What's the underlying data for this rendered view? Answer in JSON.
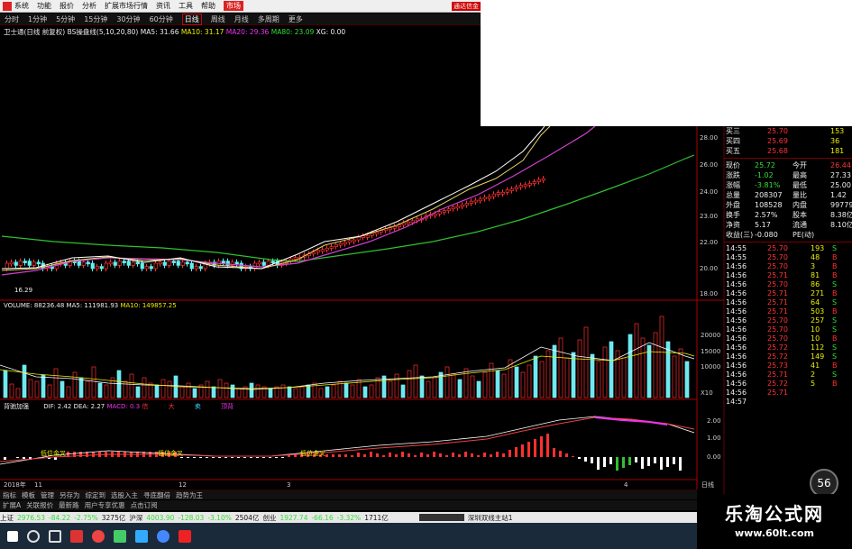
{
  "menu": {
    "items": [
      "系统",
      "功能",
      "报价",
      "分析",
      "扩展市场行情",
      "资讯",
      "工具",
      "帮助"
    ],
    "market": "市场",
    "top_right": "通达信金"
  },
  "toolbar": {
    "items": [
      "分时",
      "1分钟",
      "5分钟",
      "15分钟",
      "30分钟",
      "60分钟",
      "日线",
      "周线",
      "月线",
      "多周期",
      "更多"
    ],
    "active": "日线"
  },
  "info": {
    "stock": "卫士通(日线 前复权)",
    "indicator": "BS操盘线(5,10,20,80)",
    "ma5": "MA5: 31.66",
    "ma10": "MA10: 31.17",
    "ma20": "MA20: 29.36",
    "ma80": "MA80: 23.09",
    "xg": "XG: 0.00"
  },
  "price_axis": [
    "28.00",
    "26.00",
    "24.00",
    "23.00",
    "22.00",
    "20.00",
    "18.00"
  ],
  "low_label": "16.29",
  "volume": {
    "label": "VOLUME: 88236.48",
    "ma5": "MA5: 111981.93",
    "ma10": "MA10: 149857.25",
    "axis": [
      "20000",
      "15000",
      "10000"
    ],
    "unit": "X10"
  },
  "macd": {
    "name": "背驰加强",
    "dif": "DIF: 2.42",
    "dea": "DEA: 2.27",
    "macd": "MACD: 0.3",
    "axis": [
      "2.00",
      "1.00",
      "0.00"
    ],
    "labels": [
      "低位金叉",
      "低位金叉",
      "低位金叉"
    ],
    "legend": [
      "信",
      "大",
      "卖",
      "顶背"
    ]
  },
  "time_axis": [
    "2018年",
    "11",
    "12",
    "3",
    "4"
  ],
  "time_unit": "日线",
  "quote": {
    "rows": [
      {
        "label": "买三",
        "price": "25.70",
        "vol": "153"
      },
      {
        "label": "买四",
        "price": "25.69",
        "vol": "36"
      },
      {
        "label": "买五",
        "price": "25.68",
        "vol": "181"
      }
    ],
    "info": [
      {
        "l1": "现价",
        "v1": "25.72",
        "l2": "今开",
        "v2": "26.44"
      },
      {
        "l1": "涨跌",
        "v1": "-1.02",
        "l2": "最高",
        "v2": "27.33"
      },
      {
        "l1": "涨幅",
        "v1": "-3.81%",
        "l2": "最低",
        "v2": "25.00"
      },
      {
        "l1": "总量",
        "v1": "208307",
        "l2": "量比",
        "v2": "1.42"
      },
      {
        "l1": "外盘",
        "v1": "108528",
        "l2": "内盘",
        "v2": "99779"
      },
      {
        "l1": "换手",
        "v1": "2.57%",
        "l2": "股本",
        "v2": "8.38亿"
      },
      {
        "l1": "净资",
        "v1": "5.17",
        "l2": "流通",
        "v2": "8.10亿"
      },
      {
        "l1": "收益(三)",
        "v1": "-0.080",
        "l2": "PE(动)",
        "v2": ""
      }
    ],
    "trades": [
      {
        "t": "14:55",
        "p": "25.70",
        "v": "193",
        "d": "S"
      },
      {
        "t": "14:55",
        "p": "25.70",
        "v": "48",
        "d": "B"
      },
      {
        "t": "14:56",
        "p": "25.70",
        "v": "3",
        "d": "B"
      },
      {
        "t": "14:56",
        "p": "25.71",
        "v": "81",
        "d": "B"
      },
      {
        "t": "14:56",
        "p": "25.70",
        "v": "86",
        "d": "S"
      },
      {
        "t": "14:56",
        "p": "25.71",
        "v": "271",
        "d": "B"
      },
      {
        "t": "14:56",
        "p": "25.71",
        "v": "64",
        "d": "S"
      },
      {
        "t": "14:56",
        "p": "25.71",
        "v": "503",
        "d": "B"
      },
      {
        "t": "14:56",
        "p": "25.70",
        "v": "257",
        "d": "S"
      },
      {
        "t": "14:56",
        "p": "25.70",
        "v": "10",
        "d": "S"
      },
      {
        "t": "14:56",
        "p": "25.70",
        "v": "10",
        "d": "B"
      },
      {
        "t": "14:56",
        "p": "25.72",
        "v": "112",
        "d": "S"
      },
      {
        "t": "14:56",
        "p": "25.72",
        "v": "149",
        "d": "S"
      },
      {
        "t": "14:56",
        "p": "25.73",
        "v": "41",
        "d": "B"
      },
      {
        "t": "14:56",
        "p": "25.71",
        "v": "2",
        "d": "S"
      },
      {
        "t": "14:56",
        "p": "25.72",
        "v": "5",
        "d": "B"
      },
      {
        "t": "14:56",
        "p": "25.71",
        "v": "",
        "d": ""
      },
      {
        "t": "14:57",
        "p": "",
        "v": "",
        "d": ""
      }
    ]
  },
  "circle": "56",
  "bottom_tabs": [
    "指标",
    "模板",
    "管理",
    "另存为",
    "综定到",
    "选股入主",
    "寻底翻倍",
    "趋势为王"
  ],
  "bottom_tabs2": [
    "扩展A",
    "关联报价",
    "最新路",
    "用户专享优惠",
    "点击订阅"
  ],
  "status": {
    "sh": "上证",
    "sh_val": "2976.53",
    "sh_chg": "-84.22",
    "sh_pct": "-2.75%",
    "sh_amt": "3275亿",
    "hs": "沪深",
    "hs_val": "4003.90",
    "hs_chg": "-128.03",
    "hs_pct": "-3.10%",
    "hs_amt": "2504亿",
    "cy": "创业",
    "cy_val": "1927.74",
    "cy_chg": "-66.16",
    "cy_pct": "-3.32%",
    "cy_amt": "1711亿",
    "right": "深圳双线主站1"
  },
  "watermark": {
    "cn": "乐淘公式网",
    "url": "www.60lt.com"
  },
  "colors": {
    "up": "#ff3030",
    "down": "#60f0f0",
    "ma5": "#ffffff",
    "ma10": "#e0d060",
    "ma20": "#d040d0",
    "ma80": "#30c030"
  }
}
